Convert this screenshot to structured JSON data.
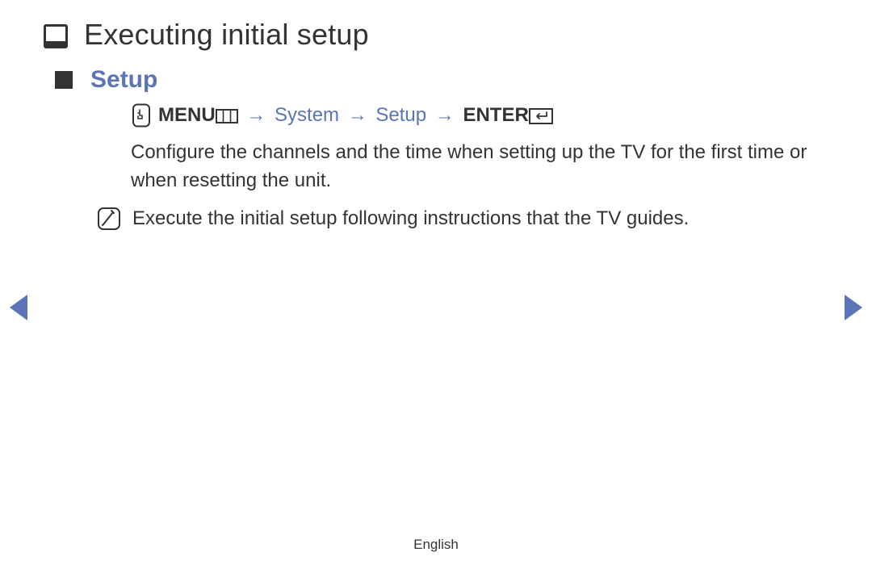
{
  "page_title": "Executing initial setup",
  "section_title": "Setup",
  "nav": {
    "menu": "MENU",
    "arrow": "→",
    "path1": "System",
    "path2": "Setup",
    "enter": "ENTER"
  },
  "body": "Configure the channels and the time when setting up the TV for the first time or when resetting the unit.",
  "note": "Execute the initial setup following instructions that the TV guides.",
  "footer": "English"
}
